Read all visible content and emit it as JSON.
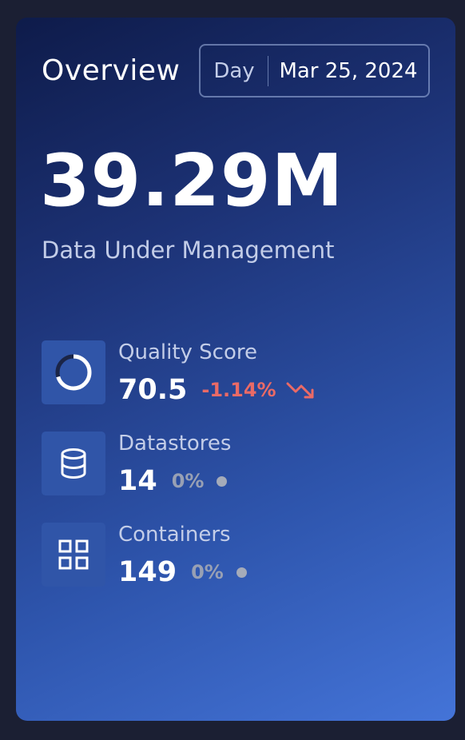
{
  "overview": {
    "title": "Overview",
    "period": "Day",
    "date": "Mar 25, 2024"
  },
  "headline": {
    "value": "39.29M",
    "label": "Data Under Management"
  },
  "stats": [
    {
      "label": "Quality Score",
      "value": "70.5",
      "delta": "-1.14%",
      "trend": "down",
      "icon": "progress-ring-icon"
    },
    {
      "label": "Datastores",
      "value": "14",
      "delta": "0%",
      "trend": "neutral",
      "icon": "database-icon"
    },
    {
      "label": "Containers",
      "value": "149",
      "delta": "0%",
      "trend": "neutral",
      "icon": "grid-icon"
    }
  ],
  "colors": {
    "negative": "#ea6a66",
    "neutral": "#98a0b4",
    "icon_tile": "#3055a8"
  }
}
